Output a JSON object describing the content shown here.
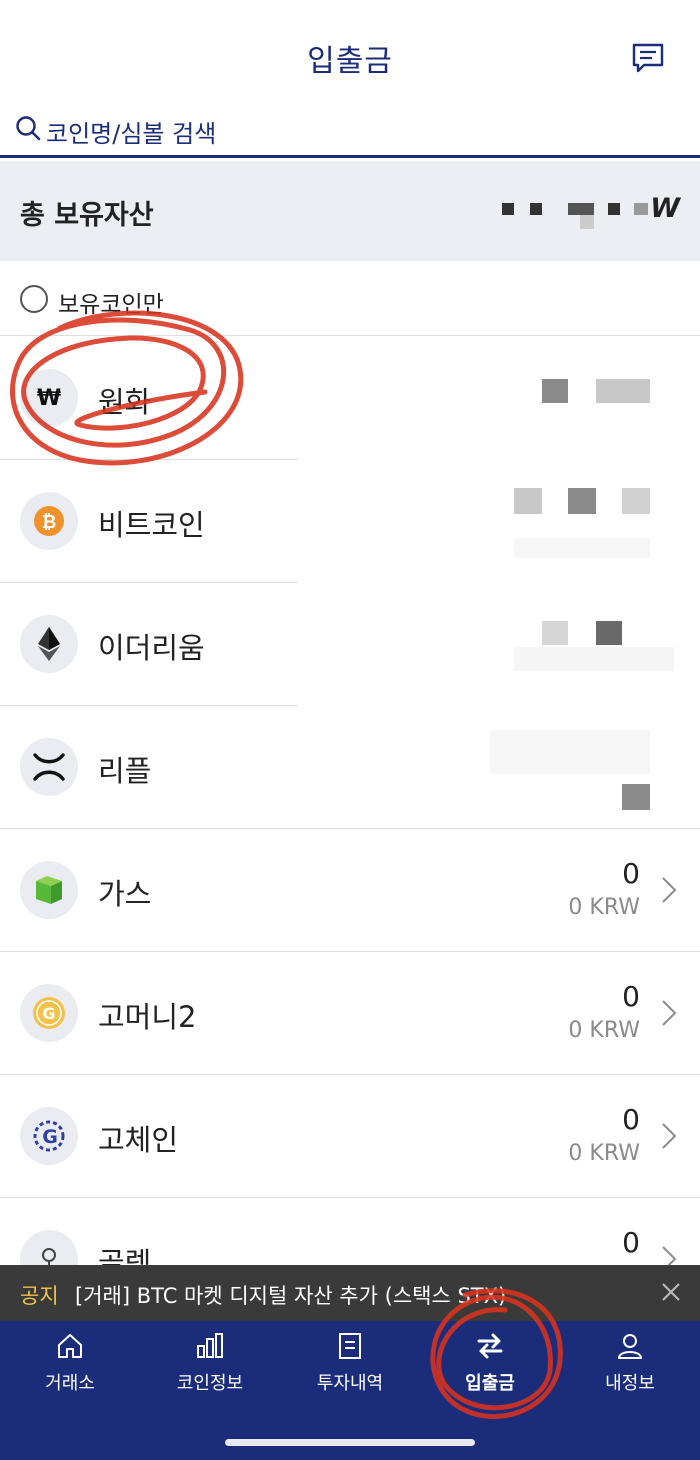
{
  "header": {
    "title": "입출금",
    "message_icon": "chat-bubble-icon"
  },
  "search": {
    "placeholder": "코인명/심볼 검색",
    "icon": "search-icon"
  },
  "total": {
    "label": "총 보유자산",
    "currency_suffix": "W"
  },
  "filter": {
    "label": "보유코인만",
    "checked": false
  },
  "coins": [
    {
      "name": "원화",
      "icon": "won-icon",
      "amount": "",
      "krw": ""
    },
    {
      "name": "비트코인",
      "icon": "bitcoin-icon",
      "amount": "",
      "krw": ""
    },
    {
      "name": "이더리움",
      "icon": "ethereum-icon",
      "amount": "",
      "krw": ""
    },
    {
      "name": "리플",
      "icon": "ripple-icon",
      "amount": "",
      "krw": ""
    },
    {
      "name": "가스",
      "icon": "gas-icon",
      "amount": "0",
      "krw": "0 KRW"
    },
    {
      "name": "고머니2",
      "icon": "gomoney-icon",
      "amount": "0",
      "krw": "0 KRW"
    },
    {
      "name": "고체인",
      "icon": "gochain-icon",
      "amount": "0",
      "krw": "0 KRW"
    },
    {
      "name": "골렘",
      "icon": "golem-icon",
      "amount": "0",
      "krw": ""
    }
  ],
  "notice": {
    "tag": "공지",
    "text": "[거래] BTC 마켓 디지털 자산 추가 (스택스 STX)"
  },
  "tabs": [
    {
      "label": "거래소",
      "icon": "home-icon",
      "active": false
    },
    {
      "label": "코인정보",
      "icon": "bar-chart-icon",
      "active": false
    },
    {
      "label": "투자내역",
      "icon": "document-icon",
      "active": false
    },
    {
      "label": "입출금",
      "icon": "transfer-icon",
      "active": true
    },
    {
      "label": "내정보",
      "icon": "person-icon",
      "active": false
    }
  ],
  "colors": {
    "brand": "#1a2c7a",
    "annotation": "#d8321e",
    "notice_tag": "#f0c24a"
  }
}
